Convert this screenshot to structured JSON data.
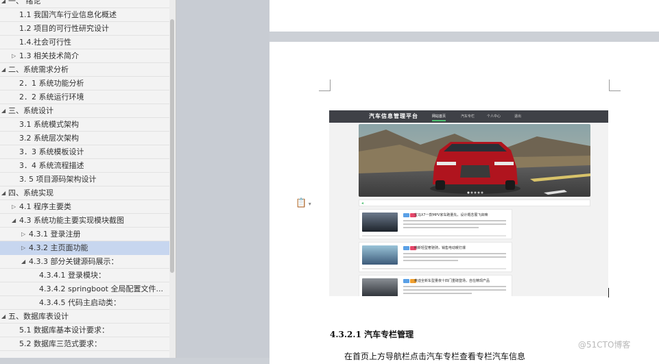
{
  "nav": {
    "items": [
      {
        "label": "一、 绪论",
        "level": 0,
        "expanded": true
      },
      {
        "label": "1.1  我国汽车行业信息化概述",
        "level": 1
      },
      {
        "label": "1.2 项目的可行性研究设计",
        "level": 1
      },
      {
        "label": "1.4.社会可行性",
        "level": 1
      },
      {
        "label": "1.3 相关技术简介",
        "level": 1,
        "collapsed": true
      },
      {
        "label": "二、系统需求分析",
        "level": 0,
        "expanded": true
      },
      {
        "label": "2．1 系统功能分析",
        "level": 1
      },
      {
        "label": "2．2 系统运行环境",
        "level": 1
      },
      {
        "label": "三、系统设计",
        "level": 0,
        "expanded": true
      },
      {
        "label": "3.1  系统模式架构",
        "level": 1
      },
      {
        "label": "3.2  系统层次架构",
        "level": 1
      },
      {
        "label": "3．3 系统模板设计",
        "level": 1
      },
      {
        "label": "3．4 系统流程描述",
        "level": 1
      },
      {
        "label": "3. 5 项目源码架构设计",
        "level": 1
      },
      {
        "label": "四、系统实现",
        "level": 0,
        "expanded": true
      },
      {
        "label": "4.1  程序主要类",
        "level": 1,
        "collapsed": true
      },
      {
        "label": "4.3 系统功能主要实现模块截图",
        "level": 1,
        "expanded": true
      },
      {
        "label": "4.3.1 登录注册",
        "level": 2,
        "collapsed": true
      },
      {
        "label": "4.3.2  主页面功能",
        "level": 2,
        "collapsed": true,
        "selected": true
      },
      {
        "label": "4.3.3 部分关键源码展示：",
        "level": 2,
        "expanded": true
      },
      {
        "label": "4.3.4.1 登录模块：",
        "level": 3
      },
      {
        "label": "4.3.4.2 springboot 全局配置文件...",
        "level": 3
      },
      {
        "label": "4.3.4.5 代码主启动类：",
        "level": 3
      },
      {
        "label": "五、数据库表设计",
        "level": 0,
        "expanded": true
      },
      {
        "label": "5.1 数据库基本设计要求：",
        "level": 1
      },
      {
        "label": "5.2 数据库三范式要求：",
        "level": 1
      }
    ]
  },
  "doc": {
    "heading": "4.3.2.1   汽车专栏管理",
    "body": "在首页上方导航栏点击汽车专栏查看专栏汽车信息",
    "watermark": "@51CTO博客"
  },
  "screenshot": {
    "title": "汽车信息管理平台",
    "nav_items": [
      "网站首页",
      "汽车专栏",
      "个人中心",
      "退出"
    ],
    "card_titles": [
      "宝马X7一款MPV家车跑量先，设计概念展飞启嘛",
      "纯新轻型奢驰骑，销售电动暖打爆",
      "奥迪全新车型量夜十四门重磅登场，自在精现产品"
    ]
  },
  "colors": {
    "nav_bg": "#f3f3f3",
    "nav_selected": "#c7d6ef",
    "workspace": "#ccd0d6",
    "car_red": "#b0141e"
  }
}
